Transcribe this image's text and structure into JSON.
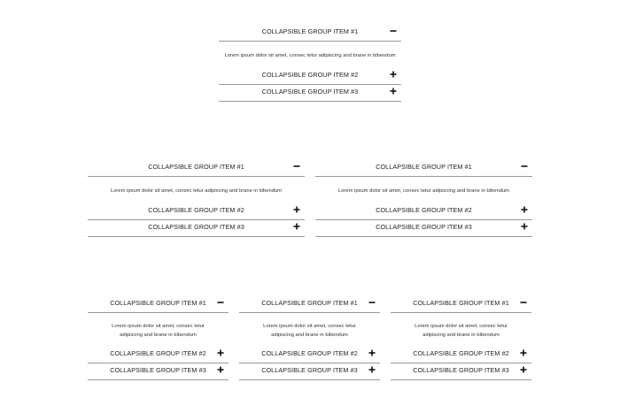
{
  "labels": {
    "item1": "COLLAPSIBLE GROUP ITEM #1",
    "item2": "COLLAPSIBLE GROUP ITEM #2",
    "item3": "COLLAPSIBLE GROUP ITEM #3",
    "body": "Lorem ipsum dolor sit amet, consec tetur adipiscing and brane in bibendum"
  },
  "icons": {
    "expanded": "minus-icon",
    "collapsed": "plus-icon"
  },
  "accordion_layouts": [
    {
      "row": 1,
      "columns": 1,
      "expanded_item": 1
    },
    {
      "row": 2,
      "columns": 2,
      "expanded_item": 1
    },
    {
      "row": 3,
      "columns": 3,
      "expanded_item": 1
    }
  ],
  "colors": {
    "divider": "#999999",
    "text": "#222222",
    "background": "#ffffff"
  }
}
